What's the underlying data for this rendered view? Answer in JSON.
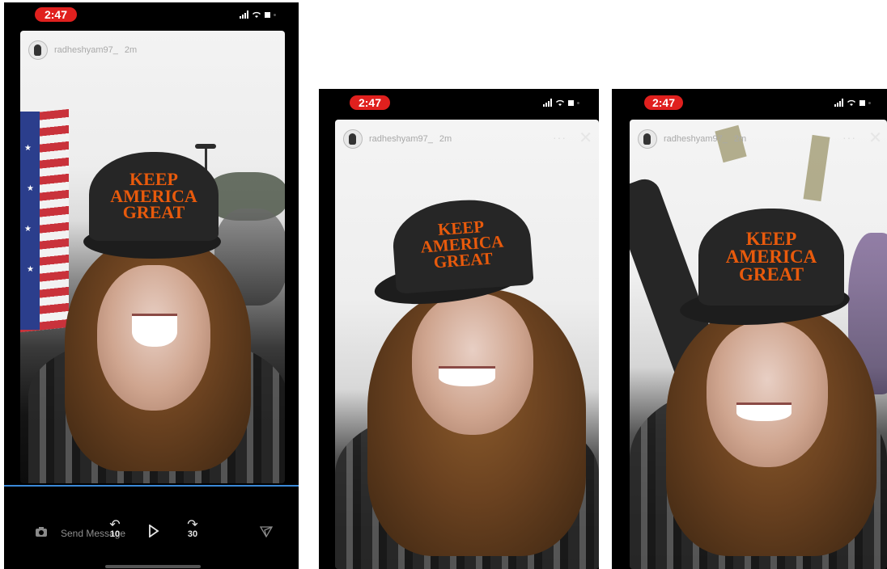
{
  "screenshots": [
    {
      "time": "2:47",
      "username": "radheshyam97_",
      "posted": "2m",
      "cap_lines": [
        "KEEP",
        "AMERICA",
        "GREAT"
      ],
      "reply_placeholder": "Send Message",
      "rewind_label": "10",
      "forward_label": "30"
    },
    {
      "time": "2:47",
      "username": "radheshyam97_",
      "posted": "2m",
      "cap_lines": [
        "KEEP",
        "AMERICA",
        "GREAT"
      ]
    },
    {
      "time": "2:47",
      "username": "radheshyam97_",
      "posted": "2m",
      "cap_lines": [
        "KEEP",
        "AMERICA",
        "GREAT"
      ]
    }
  ],
  "colors": {
    "time_pill": "#e0201e",
    "cap_text": "#e85a0c",
    "progress": "#3b8ad9"
  },
  "icons": [
    "camera-icon",
    "rewind-10-icon",
    "play-icon",
    "forward-30-icon",
    "send-icon",
    "close-icon",
    "more-icon"
  ]
}
